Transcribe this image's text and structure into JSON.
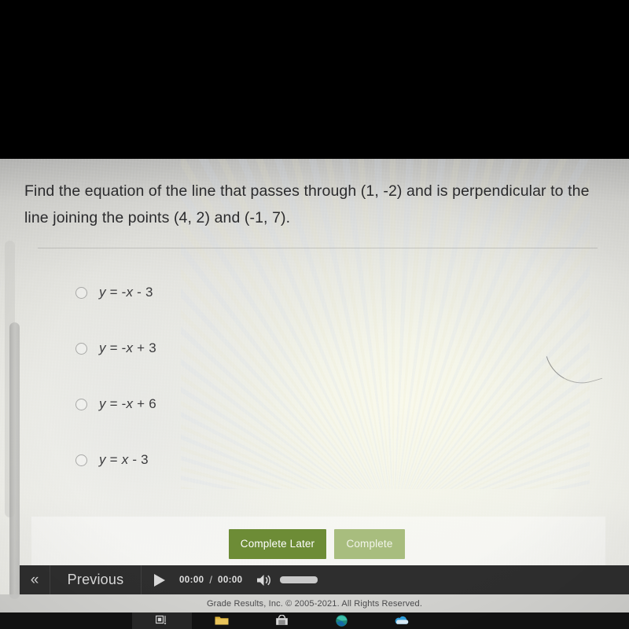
{
  "question": {
    "text": "Find the equation of the line that passes through (1, -2) and is perpendicular to the line joining the points (4, 2) and (-1, 7)."
  },
  "options": [
    {
      "id": "option-a",
      "label": "y = -x - 3",
      "selected": false
    },
    {
      "id": "option-b",
      "label": "y = -x + 3",
      "selected": false
    },
    {
      "id": "option-c",
      "label": "y = -x + 6",
      "selected": false
    },
    {
      "id": "option-d",
      "label": "y = x - 3",
      "selected": false
    }
  ],
  "actions": {
    "complete_later_label": "Complete Later",
    "complete_label": "Complete",
    "complete_later_color": "#6d8c36",
    "complete_color": "#a8bd7e"
  },
  "toolbar": {
    "previous_arrow": "«",
    "previous_label": "Previous",
    "play_icon": "play-icon",
    "current_time": "00:00",
    "time_separator": "/",
    "total_time": "00:00",
    "speaker_icon": "speaker-icon",
    "volume_level": 100,
    "background_color": "#2e2e2e"
  },
  "footer": {
    "copyright": "Grade Results, Inc. © 2005-2021. All Rights Reserved."
  },
  "taskbar": {
    "icons": [
      {
        "name": "task-view-icon"
      },
      {
        "name": "file-explorer-icon"
      },
      {
        "name": "microsoft-store-icon"
      },
      {
        "name": "edge-browser-icon"
      },
      {
        "name": "onedrive-icon"
      }
    ]
  }
}
